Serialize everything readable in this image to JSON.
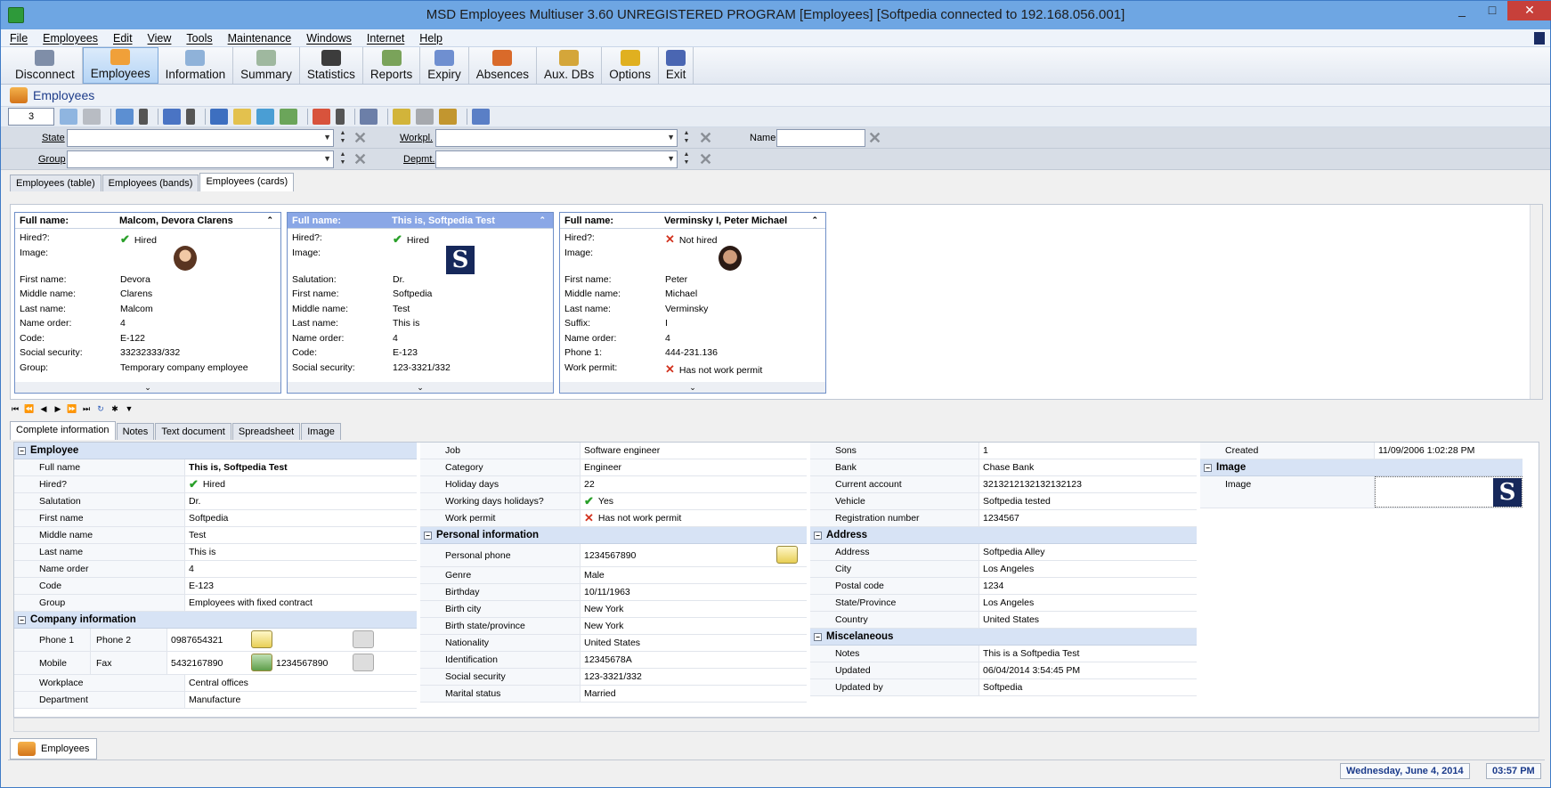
{
  "window": {
    "title": "MSD Employees Multiuser 3.60 UNREGISTERED PROGRAM [Employees] [Softpedia connected to 192.168.056.001]",
    "controls": [
      "_",
      "□",
      "✕"
    ]
  },
  "menu": [
    "File",
    "Employees",
    "Edit",
    "View",
    "Tools",
    "Maintenance",
    "Windows",
    "Internet",
    "Help"
  ],
  "toolbar": [
    {
      "label": "Disconnect",
      "icon": "disconnect-icon",
      "color": "#7f8ea8"
    },
    {
      "label": "Employees",
      "icon": "employees-icon",
      "color": "#f0a039",
      "active": true
    },
    {
      "label": "Information",
      "icon": "information-icon",
      "color": "#8fb2d9"
    },
    {
      "label": "Summary",
      "icon": "summary-icon",
      "color": "#9fb89f"
    },
    {
      "label": "Statistics",
      "icon": "statistics-icon",
      "color": "#3c3c3c"
    },
    {
      "label": "Reports",
      "icon": "reports-icon",
      "color": "#7aa35a"
    },
    {
      "label": "Expiry",
      "icon": "clock-icon",
      "color": "#6f8fd0"
    },
    {
      "label": "Absences",
      "icon": "house-icon",
      "color": "#d96a2a"
    },
    {
      "label": "Aux. DBs",
      "icon": "database-icon",
      "color": "#d4a63a"
    },
    {
      "label": "Options",
      "icon": "gears-icon",
      "color": "#e0b020"
    },
    {
      "label": "Exit",
      "icon": "exit-icon",
      "color": "#4a66b2"
    }
  ],
  "section_title": "Employees",
  "record_count": "3",
  "filters": {
    "state_label": "State",
    "group_label": "Group",
    "workpl_label": "Workpl.",
    "depmt_label": "Depmt.",
    "name_label": "Name"
  },
  "view_tabs": [
    "Employees (table)",
    "Employees (bands)",
    "Employees (cards)"
  ],
  "cards": [
    {
      "full_name_label": "Full name:",
      "full_name": "Malcom, Devora Clarens",
      "rows": [
        {
          "k": "Hired?:",
          "v": "Hired",
          "mark": "check"
        },
        {
          "k": "Image:",
          "v": ""
        },
        {
          "k": "First name:",
          "v": "Devora"
        },
        {
          "k": "Middle name:",
          "v": "Clarens"
        },
        {
          "k": "Last name:",
          "v": "Malcom"
        },
        {
          "k": "Name order:",
          "v": "4"
        },
        {
          "k": "Code:",
          "v": "E-122"
        },
        {
          "k": "Social security:",
          "v": "33232333/332"
        },
        {
          "k": "Group:",
          "v": "Temporary company employee"
        }
      ]
    },
    {
      "full_name_label": "Full name:",
      "full_name": "This is, Softpedia Test",
      "rows": [
        {
          "k": "Hired?:",
          "v": "Hired",
          "mark": "check"
        },
        {
          "k": "Image:",
          "v": ""
        },
        {
          "k": "Salutation:",
          "v": "Dr."
        },
        {
          "k": "First name:",
          "v": "Softpedia"
        },
        {
          "k": "Middle name:",
          "v": "Test"
        },
        {
          "k": "Last name:",
          "v": "This is"
        },
        {
          "k": "Name order:",
          "v": "4"
        },
        {
          "k": "Code:",
          "v": "E-123"
        },
        {
          "k": "Social security:",
          "v": "123-3321/332"
        }
      ]
    },
    {
      "full_name_label": "Full name:",
      "full_name": "Verminsky I, Peter Michael",
      "rows": [
        {
          "k": "Hired?:",
          "v": "Not hired",
          "mark": "cross"
        },
        {
          "k": "Image:",
          "v": ""
        },
        {
          "k": "First name:",
          "v": "Peter"
        },
        {
          "k": "Middle name:",
          "v": "Michael"
        },
        {
          "k": "Last name:",
          "v": "Verminsky"
        },
        {
          "k": "Suffix:",
          "v": "I"
        },
        {
          "k": "Name order:",
          "v": "4"
        },
        {
          "k": "Phone 1:",
          "v": "444-231.136"
        },
        {
          "k": "Work permit:",
          "v": "Has not work permit",
          "mark": "cross"
        }
      ]
    }
  ],
  "detail_tabs": [
    "Complete information",
    "Notes",
    "Text document",
    "Spreadsheet",
    "Image"
  ],
  "col1": {
    "group1": "Employee",
    "rows1": [
      {
        "k": "Full name",
        "v": "This is, Softpedia Test",
        "bold": true
      },
      {
        "k": "Hired?",
        "v": "Hired",
        "mark": "check"
      },
      {
        "k": "Salutation",
        "v": "Dr."
      },
      {
        "k": "First name",
        "v": "Softpedia"
      },
      {
        "k": "Middle name",
        "v": "Test"
      },
      {
        "k": "Last name",
        "v": "This is"
      },
      {
        "k": "Name order",
        "v": "4"
      },
      {
        "k": "Code",
        "v": "E-123"
      },
      {
        "k": "Group",
        "v": "Employees with fixed contract"
      }
    ],
    "group2": "Company information",
    "phone1_label": "Phone 1",
    "phone2_label": "Phone 2",
    "phone1": "0987654321",
    "mobile_label": "Mobile",
    "fax_label": "Fax",
    "mobile": "5432167890",
    "fax": "1234567890",
    "rows2": [
      {
        "k": "Workplace",
        "v": "Central offices"
      },
      {
        "k": "Department",
        "v": "Manufacture"
      }
    ]
  },
  "col2": {
    "rows1": [
      {
        "k": "Job",
        "v": "Software engineer"
      },
      {
        "k": "Category",
        "v": "Engineer"
      },
      {
        "k": "Holiday days",
        "v": "22"
      },
      {
        "k": "Working days holidays?",
        "v": "Yes",
        "mark": "check"
      },
      {
        "k": "Work permit",
        "v": "Has not work permit",
        "mark": "cross"
      }
    ],
    "group": "Personal information",
    "personal_phone_label": "Personal phone",
    "personal_phone": "1234567890",
    "rows2": [
      {
        "k": "Genre",
        "v": "Male"
      },
      {
        "k": "Birthday",
        "v": "10/11/1963"
      },
      {
        "k": "Birth city",
        "v": "New York"
      },
      {
        "k": "Birth state/province",
        "v": "New York"
      },
      {
        "k": "Nationality",
        "v": "United States"
      },
      {
        "k": "Identification",
        "v": "12345678A"
      },
      {
        "k": "Social security",
        "v": "123-3321/332"
      },
      {
        "k": "Marital status",
        "v": "Married"
      }
    ]
  },
  "col3": {
    "rows1": [
      {
        "k": "Sons",
        "v": "1"
      },
      {
        "k": "Bank",
        "v": "Chase Bank"
      },
      {
        "k": "Current account",
        "v": "3213212132132132123"
      },
      {
        "k": "Vehicle",
        "v": "Softpedia tested"
      },
      {
        "k": "Registration number",
        "v": "1234567"
      }
    ],
    "group1": "Address",
    "rows2": [
      {
        "k": "Address",
        "v": "Softpedia Alley"
      },
      {
        "k": "City",
        "v": "Los Angeles"
      },
      {
        "k": "Postal code",
        "v": "1234"
      },
      {
        "k": "State/Province",
        "v": "Los Angeles"
      },
      {
        "k": "Country",
        "v": "United States"
      }
    ],
    "group2": "Miscelaneous",
    "rows3": [
      {
        "k": "Notes",
        "v": "This is a Softpedia Test"
      },
      {
        "k": "Updated",
        "v": "06/04/2014 3:54:45 PM"
      },
      {
        "k": "Updated by",
        "v": "Softpedia"
      }
    ]
  },
  "col4": {
    "created_label": "Created",
    "created": "11/09/2006 1:02:28 PM",
    "group": "Image",
    "image_label": "Image"
  },
  "bottom_tab": "Employees",
  "status": {
    "date": "Wednesday, June 4, 2014",
    "time": "03:57 PM"
  }
}
